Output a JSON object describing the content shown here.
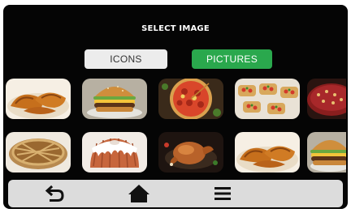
{
  "screen": {
    "title": "SELECT IMAGE"
  },
  "mode_toggle": {
    "icons_label": "ICONS",
    "pictures_label": "PICTURES",
    "selected": "PICTURES",
    "selected_color": "#2aa84d"
  },
  "gallery": {
    "rows": [
      [
        "croissants",
        "burger",
        "pizza",
        "bruschetta",
        "cake"
      ],
      [
        "pie",
        "bundt-cake",
        "roast-chicken",
        "croissants",
        "burger"
      ]
    ]
  },
  "nav_bar": {
    "items": [
      "back-icon",
      "home-icon",
      "menu-icon"
    ]
  }
}
